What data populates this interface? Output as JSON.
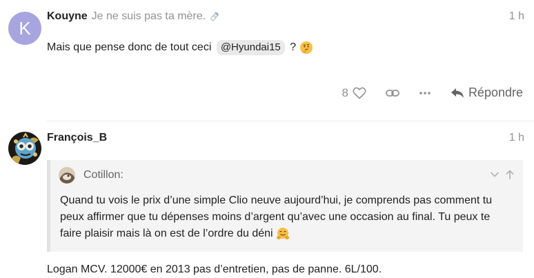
{
  "post1": {
    "avatar_letter": "K",
    "avatar_color": "#a8a4df",
    "username": "Kouyne",
    "user_title": "Je ne suis pas ta mère.",
    "user_title_icon": "baby-bottle-icon",
    "time": "1 h",
    "text_before": "Mais que pense donc de tout ceci",
    "mention": "@Hyundai15",
    "text_after": "?",
    "emoji": "thinking-face-icon",
    "actions": {
      "like_count": "8",
      "reply_label": "Répondre"
    }
  },
  "post2": {
    "username": "François_B",
    "time": "1 h",
    "quote": {
      "author": "Cotillon:",
      "text": "Quand tu vois le prix d’une simple Clio neuve aujourd’hui, je comprends pas comment tu peux affirmer que tu dépenses moins d’argent qu’avec une occasion au final. Tu peux te faire plaisir mais là on est de l’ordre du déni",
      "emoji": "hugging-face-icon"
    },
    "text": "Logan MCV. 12000€ en 2013 pas d’entretien, pas de panne. 6L/100."
  }
}
